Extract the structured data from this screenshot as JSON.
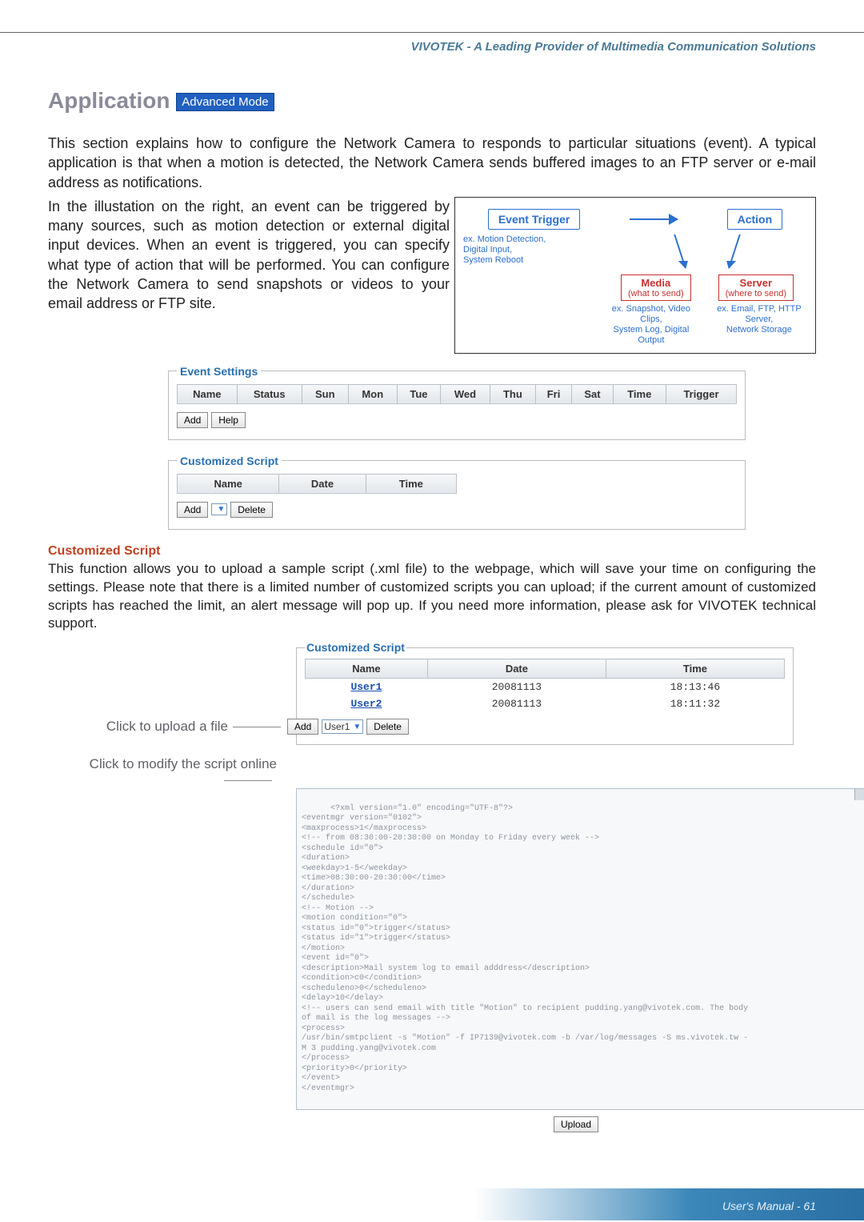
{
  "header": {
    "brand_line": "VIVOTEK - A Leading Provider of Multimedia Communication Solutions"
  },
  "page": {
    "title": "Application",
    "badge": "Advanced Mode",
    "para1": "This section explains how to configure the Network Camera to responds to particular situations (event). A typical application is that when a motion is detected, the Network Camera sends buffered images to an FTP server or e-mail address as notifications.",
    "para2": "In the illustation on the right, an event can be triggered by many sources, such as motion detection or external digital input devices. When an event is triggered, you can specify what type of action that will be performed. You can configure the Network Camera to send snapshots or videos to your email address or FTP site."
  },
  "diagram": {
    "trigger": "Event Trigger",
    "action": "Action",
    "trigger_ex": "ex. Motion Detection,\nDigital Input,\nSystem Reboot",
    "media_title": "Media",
    "media_sub": "(what to send)",
    "server_title": "Server",
    "server_sub": "(where to send)",
    "media_ex": "ex. Snapshot, Video Clips,\nSystem Log, Digital Output",
    "server_ex": "ex. Email, FTP, HTTP Server,\nNetwork Storage"
  },
  "event_settings": {
    "legend": "Event Settings",
    "cols": [
      "Name",
      "Status",
      "Sun",
      "Mon",
      "Tue",
      "Wed",
      "Thu",
      "Fri",
      "Sat",
      "Time",
      "Trigger"
    ],
    "add": "Add",
    "help": "Help"
  },
  "cust1": {
    "legend": "Customized Script",
    "cols": [
      "Name",
      "Date",
      "Time"
    ],
    "add": "Add",
    "delete": "Delete",
    "dropdown_placeholder": ""
  },
  "section_cs": {
    "heading": "Customized Script",
    "para": "This function allows you to upload a sample script (.xml file) to the webpage, which will save your time on configuring the settings. Please note that there is a limited number of customized scripts you can upload; if the current amount of customized scripts has reached the limit, an alert message will pop up. If you need more information, please ask for VIVOTEK technical support."
  },
  "cust2": {
    "legend": "Customized Script",
    "cols": [
      "Name",
      "Date",
      "Time"
    ],
    "rows": [
      {
        "name": "User1",
        "date": "20081113",
        "time": "18:13:46"
      },
      {
        "name": "User2",
        "date": "20081113",
        "time": "18:11:32"
      }
    ],
    "add": "Add",
    "delete": "Delete",
    "select": "User1"
  },
  "labels": {
    "upload": "Click to upload a file",
    "modify": "Click to modify the script online"
  },
  "code": "<?xml version=\"1.0\" encoding=\"UTF-8\"?>\n<eventmgr version=\"0102\">\n<maxprocess>1</maxprocess>\n<!-- from 08:30:00-20:30:00 on Monday to Friday every week -->\n<schedule id=\"0\">\n<duration>\n<weekday>1-5</weekday>\n<time>08:30:00-20:30:00</time>\n</duration>\n</schedule>\n<!-- Motion -->\n<motion condition=\"0\">\n<status id=\"0\">trigger</status>\n<status id=\"1\">trigger</status>\n</motion>\n<event id=\"0\">\n<description>Mail system log to email adddress</description>\n<condition>c0</condition>\n<scheduleno>0</scheduleno>\n<delay>10</delay>\n<!-- users can send email with title \"Motion\" to recipient pudding.yang@vivotek.com. The body\nof mail is the log messages -->\n<process>\n/usr/bin/smtpclient -s \"Motion\" -f IP7139@vivotek.com -b /var/log/messages -S ms.vivotek.tw -\nM 3 pudding.yang@vivotek.com\n</process>\n<priority>0</priority>\n</event>\n</eventmgr>",
  "upload_btn": "Upload",
  "footer": "User's Manual - 61"
}
